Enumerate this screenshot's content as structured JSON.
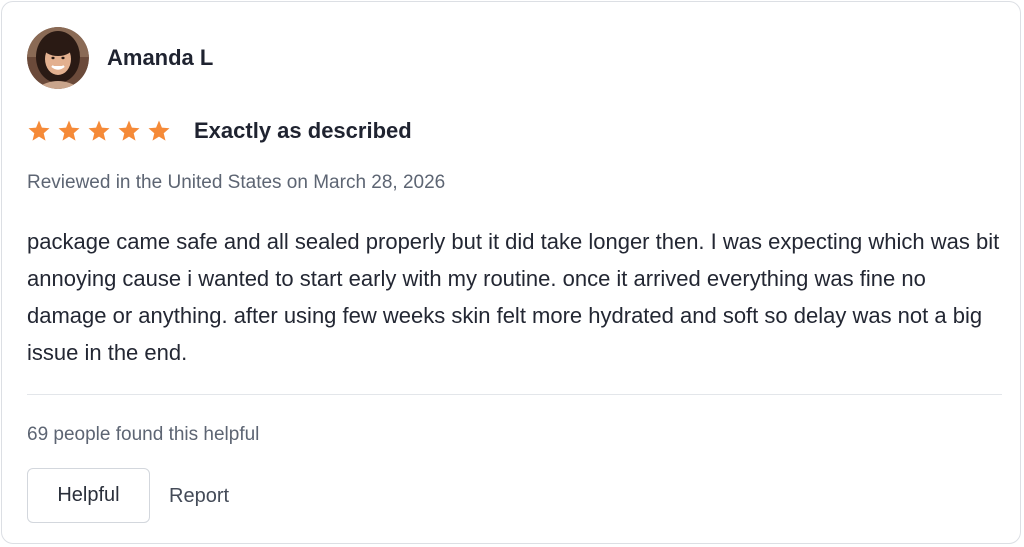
{
  "reviewer": {
    "name": "Amanda L",
    "avatar_icon": "user-avatar-photo"
  },
  "review": {
    "rating": 5,
    "rating_max": 5,
    "star_color": "#f58a38",
    "title": "Exactly as described",
    "meta": "Reviewed in the United States on March 28, 2026",
    "body": "package came safe and all sealed properly but it did take longer then. I was expecting which was bit annoying cause i wanted to start early with my routine. once it arrived everything was fine no damage or anything. after using few weeks skin felt more hydrated and soft so delay was not a big issue in the end."
  },
  "footer": {
    "helpful_count_text": "69 people found this helpful",
    "helpful_button_label": "Helpful",
    "report_label": "Report"
  }
}
